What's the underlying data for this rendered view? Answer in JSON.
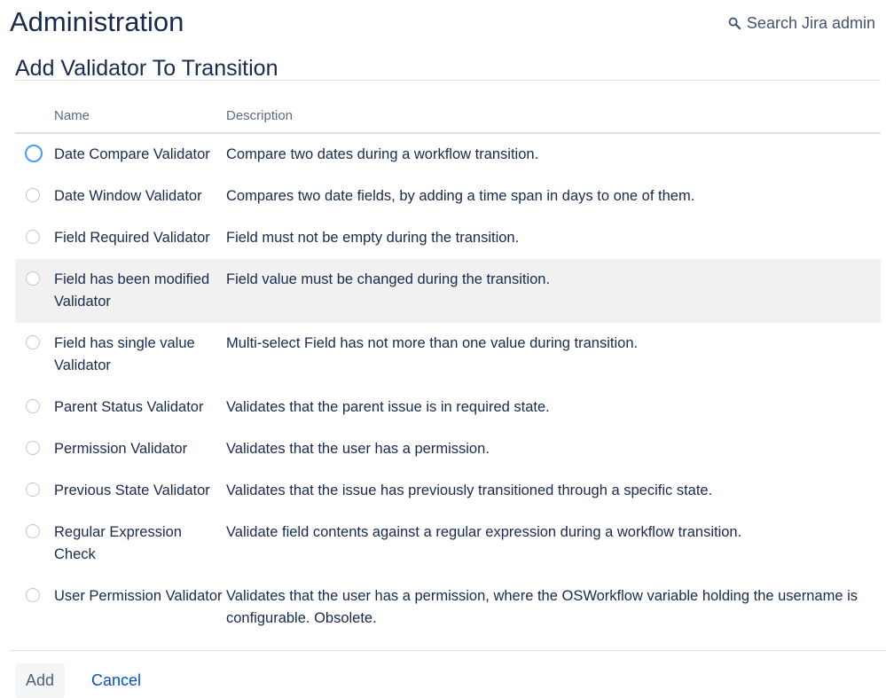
{
  "header": {
    "title": "Administration",
    "search_label": "Search Jira admin"
  },
  "section": {
    "title": "Add Validator To Transition"
  },
  "table": {
    "columns": [
      "Name",
      "Description"
    ],
    "rows": [
      {
        "name": "Date Compare Validator",
        "description": "Compare two dates during a workflow transition."
      },
      {
        "name": "Date Window Validator",
        "description": "Compares two date fields, by adding a time span in days to one of them."
      },
      {
        "name": "Field Required Validator",
        "description": "Field must not be empty during the transition."
      },
      {
        "name": "Field has been modified Validator",
        "description": "Field value must be changed during the transition."
      },
      {
        "name": "Field has single value Validator",
        "description": "Multi-select Field has not more than one value during transition."
      },
      {
        "name": "Parent Status Validator",
        "description": "Validates that the parent issue is in required state."
      },
      {
        "name": "Permission Validator",
        "description": "Validates that the user has a permission."
      },
      {
        "name": "Previous State Validator",
        "description": "Validates that the issue has previously transitioned through a specific state."
      },
      {
        "name": "Regular Expression Check",
        "description": "Validate field contents against a regular expression during a workflow transition."
      },
      {
        "name": "User Permission Validator",
        "description": "Validates that the user has a permission, where the OSWorkflow variable holding the username is configurable. Obsolete."
      }
    ]
  },
  "footer": {
    "add_label": "Add",
    "cancel_label": "Cancel"
  },
  "colors": {
    "heading": "#172b4d",
    "link": "#0052cc",
    "focus_ring": "#4c9aff",
    "row_highlight": "#f1f1f1"
  },
  "icons": {
    "search": "search-icon"
  }
}
